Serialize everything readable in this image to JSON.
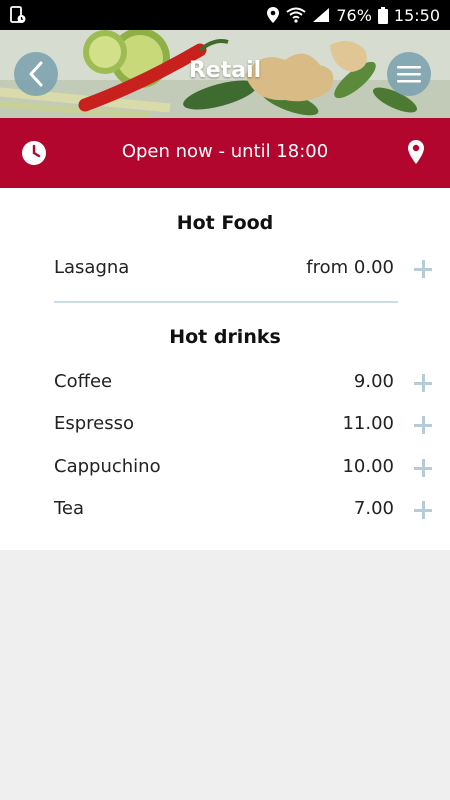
{
  "status_bar": {
    "battery_percent": "76%",
    "time": "15:50",
    "icons": [
      "sim-notification-icon",
      "location-icon",
      "wifi-icon",
      "signal-icon",
      "battery-icon"
    ]
  },
  "header": {
    "title": "Retail",
    "back_icon": "chevron-left-icon",
    "menu_icon": "hamburger-menu-icon"
  },
  "open_bar": {
    "status_text": "Open now - until 18:00",
    "left_icon": "clock-icon",
    "right_icon": "map-pin-icon",
    "color": "#b3062f"
  },
  "menu": {
    "sections": [
      {
        "title": "Hot Food",
        "items": [
          {
            "name": "Lasagna",
            "price": "from 0.00"
          }
        ]
      },
      {
        "title": "Hot drinks",
        "items": [
          {
            "name": "Coffee",
            "price": "9.00"
          },
          {
            "name": "Espresso",
            "price": "11.00"
          },
          {
            "name": "Cappuchino",
            "price": "10.00"
          },
          {
            "name": "Tea",
            "price": "7.00"
          }
        ]
      }
    ]
  },
  "colors": {
    "accent_red": "#b3062f",
    "plus_icon": "#b5cbd5",
    "divider": "#c9dde7",
    "page_background": "#efefef"
  }
}
